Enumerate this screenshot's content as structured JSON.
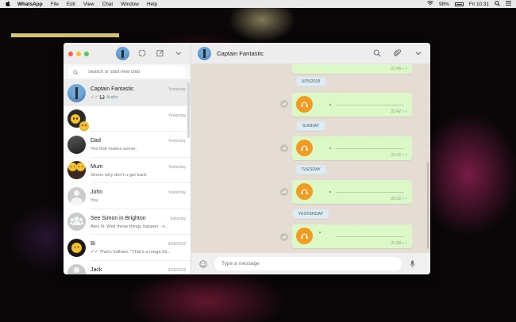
{
  "menubar": {
    "apple": "",
    "app_name": "WhatsApp",
    "items": [
      "File",
      "Edit",
      "View",
      "Chat",
      "Window",
      "Help"
    ],
    "battery": "98%",
    "clock": "Fri 10:31"
  },
  "sidebar": {
    "search_placeholder": "Search or start new chat",
    "chats": [
      {
        "name": "Captain Fantastic",
        "time": "Yesterday",
        "preview": "✓✓ 🎧 Audio",
        "avatar": "blue",
        "active": true
      },
      {
        "name": "",
        "time": "Yesterday",
        "preview": "",
        "avatar": "emoji-duo"
      },
      {
        "name": "Dad",
        "time": "Yesterday",
        "preview": "Yes that makes sense.",
        "avatar": "dark"
      },
      {
        "name": "Mum",
        "time": "Yesterday",
        "preview": "Simon why don't u get back",
        "avatar": "emoji-pair"
      },
      {
        "name": "John",
        "time": "Yesterday",
        "preview": "You",
        "avatar": "grey"
      },
      {
        "name": "See Simon in Brighton",
        "time": "Saturday",
        "preview": "Alex N: Well these things happen - e...",
        "avatar": "group"
      },
      {
        "name": "Bi",
        "time": "9/29/2018",
        "preview": "✓✓ That's brilliant. \"That's a mega bli...",
        "avatar": "emoji-dark"
      },
      {
        "name": "Jack",
        "time": "9/29/2018",
        "preview": "",
        "avatar": "grey"
      }
    ]
  },
  "conversation": {
    "contact_name": "Captain Fantastic",
    "messages": [
      {
        "type": "audio",
        "time": "21:45",
        "ticks": "✓✓"
      },
      {
        "type": "date",
        "label": "9/25/2018"
      },
      {
        "type": "audio",
        "time": "22:42",
        "ticks": "✓✓"
      },
      {
        "type": "date",
        "label": "SUNDAY"
      },
      {
        "type": "audio",
        "time": "21:42",
        "ticks": "✓✓"
      },
      {
        "type": "date",
        "label": "TUESDAY"
      },
      {
        "type": "audio",
        "time": "22:22",
        "ticks": "✓✓"
      },
      {
        "type": "date",
        "label": "YESTERDAY"
      },
      {
        "type": "audio",
        "time": "21:58",
        "ticks": "✓✓"
      }
    ],
    "composer_placeholder": "Type a message"
  },
  "colors": {
    "accent_green_bubble": "#dcf8c6",
    "audio_orange": "#f29b23",
    "read_tick_blue": "#4fb6ec",
    "date_chip": "#ddecf3"
  },
  "icons": [
    "apple-icon",
    "wifi-icon",
    "battery-icon",
    "search-icon",
    "spotlight-icon",
    "status-icon",
    "new-chat-icon",
    "chevron-down-icon",
    "attach-icon",
    "play-icon",
    "forward-icon",
    "emoji-icon",
    "mic-icon"
  ]
}
